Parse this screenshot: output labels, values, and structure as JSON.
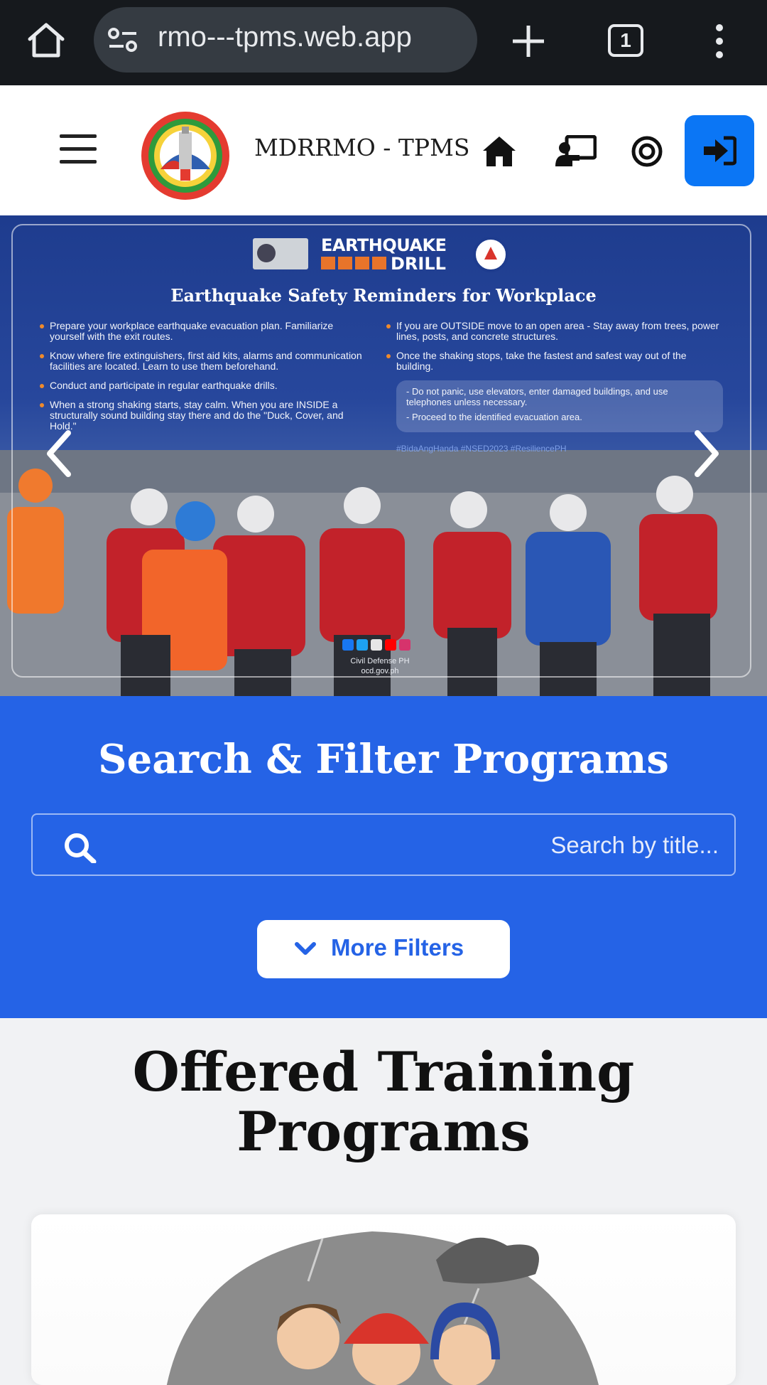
{
  "browser": {
    "url": "rmo---tpms.web.app",
    "tab_count": "1"
  },
  "header": {
    "brand": "MDRRMO - TPMS"
  },
  "carousel": {
    "drill_title_line1": "EARTHQUAKE",
    "drill_title_line2": "DRILL",
    "slide_title": "Earthquake Safety Reminders for Workplace",
    "left_items": [
      "Prepare your workplace earthquake evacuation plan. Familiarize yourself with the exit routes.",
      "Know where fire extinguishers, first aid kits, alarms and communication facilities are located. Learn to use them beforehand.",
      "Conduct and participate in regular earthquake drills.",
      "When a strong shaking starts, stay calm. When you are INSIDE a structurally sound building stay there and do the \"Duck, Cover, and Hold.\""
    ],
    "right_items": [
      "If you are OUTSIDE move to an open area - Stay away from trees, power lines, posts, and concrete structures.",
      "Once the shaking stops, take the fastest and safest way out of the building."
    ],
    "note_lines": [
      "- Do not panic, use elevators, enter damaged buildings, and use telephones unless necessary.",
      "- Proceed to the identified evacuation area."
    ],
    "hashtags": "#BidaAngHanda #NSED2023 #ResiliencePH",
    "credit_line1": "Civil Defense PH",
    "credit_line2": "ocd.gov.ph"
  },
  "search": {
    "heading": "Search & Filter Programs",
    "placeholder": "Search by title...",
    "filters_label": "More Filters"
  },
  "programs": {
    "heading": "Offered Training Programs"
  },
  "colors": {
    "chrome_bg": "#16191d",
    "accent_blue": "#2563e6",
    "login_blue": "#0b76f5",
    "page_bg": "#f1f2f4"
  },
  "icons": [
    "home-icon",
    "tune-icon",
    "plus-icon",
    "kebab-icon",
    "hamburger-icon",
    "house-icon",
    "teacher-icon",
    "target-icon",
    "login-icon",
    "chevron-left-icon",
    "chevron-right-icon",
    "search-icon",
    "chevron-down-icon"
  ]
}
